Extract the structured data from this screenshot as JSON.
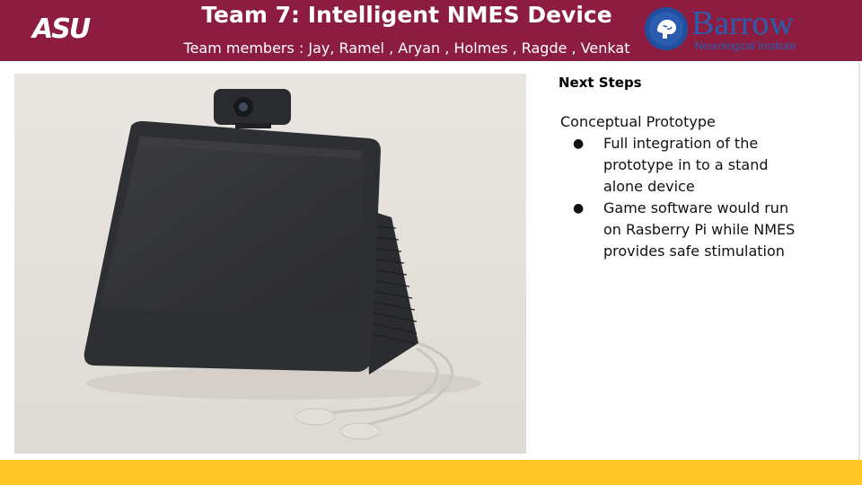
{
  "header": {
    "left_logo_text": "ASU",
    "title": "Team 7: Intelligent NMES Device",
    "subtitle": "Team members : Jay, Ramel , Aryan , Holmes , Ragde , Venkat",
    "right_logo_name": "Barrow",
    "right_logo_sub": "Neurological Institute"
  },
  "side_panel": {
    "title": "Next Steps",
    "intro": "Conceptual Prototype",
    "bullets": [
      "Full integration of the prototype in to a stand alone device",
      "Game software would run on Rasberry Pi while NMES provides safe stimulation"
    ]
  },
  "colors": {
    "header_bg": "#8c1d40",
    "footer_bg": "#ffc627",
    "barrow_blue": "#2a5db0"
  },
  "icons": {
    "bullet": "●"
  }
}
